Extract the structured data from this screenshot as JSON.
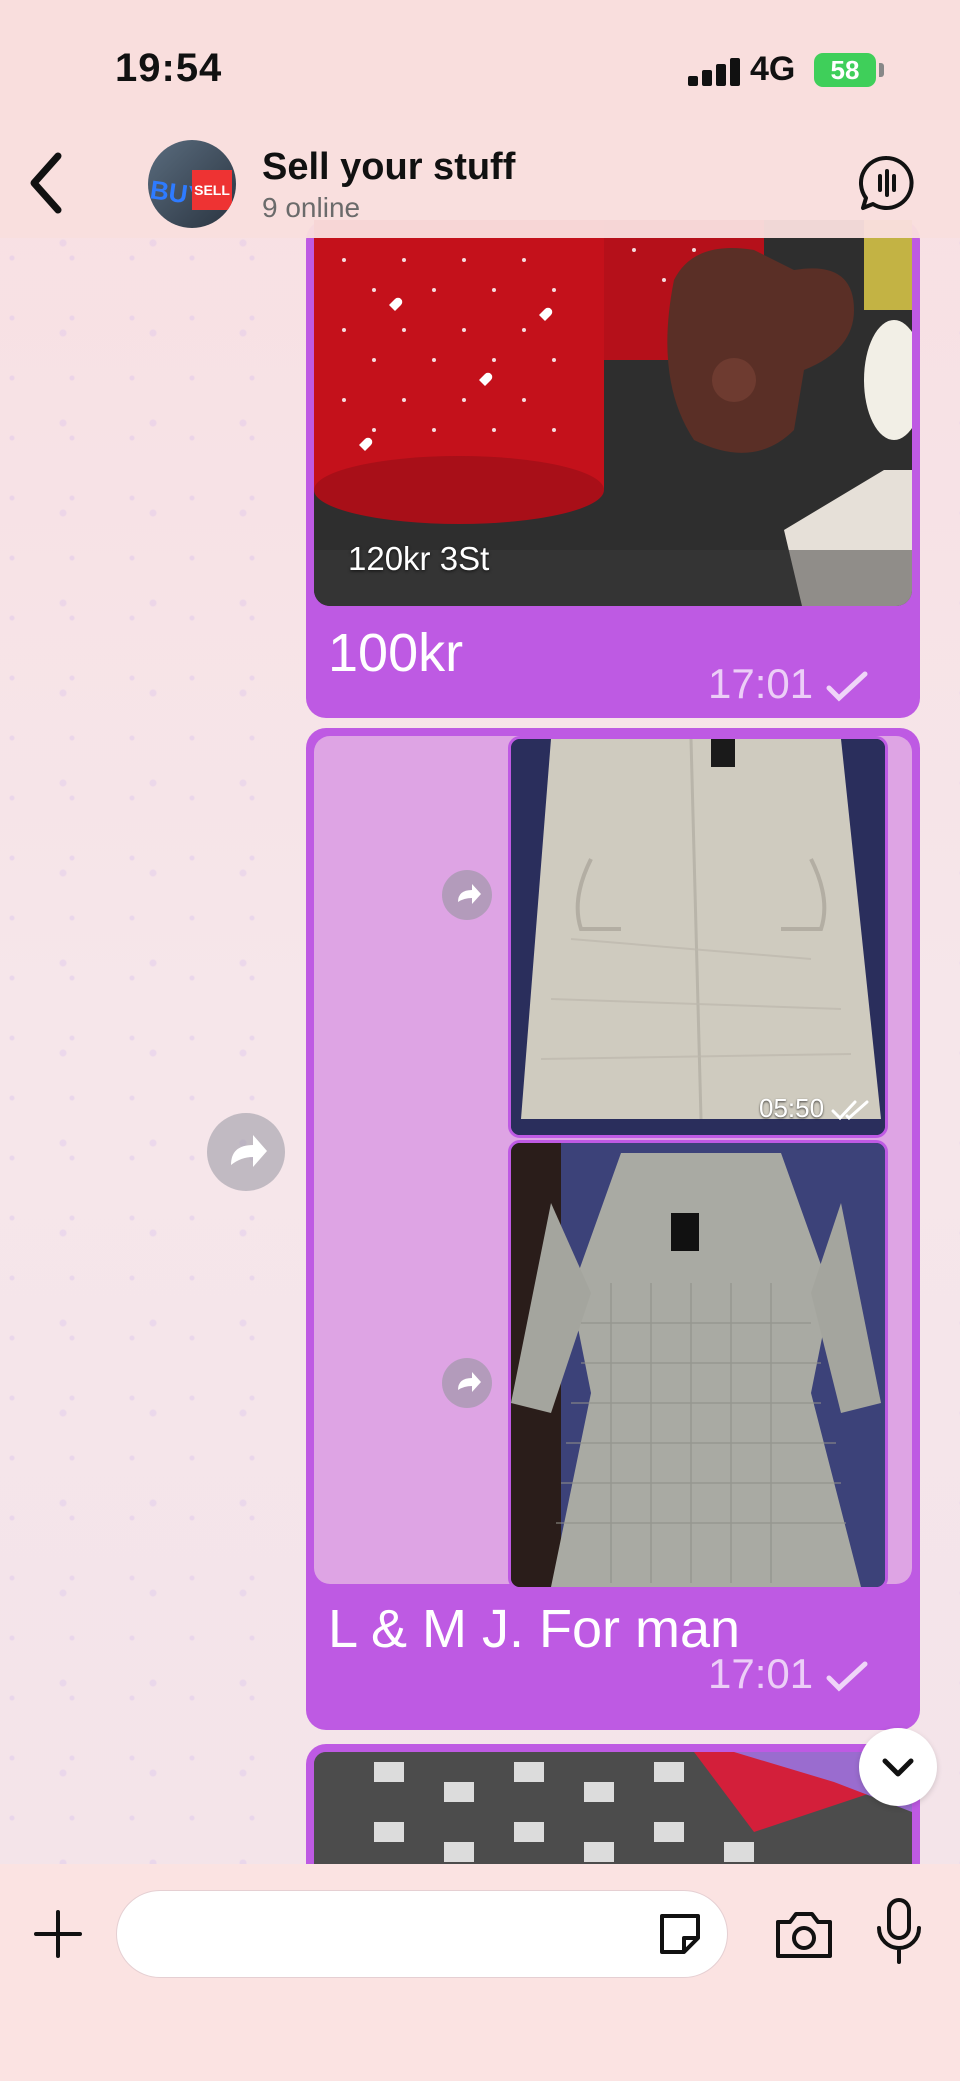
{
  "status_bar": {
    "time": "19:54",
    "network": "4G",
    "battery": "58"
  },
  "header": {
    "title": "Sell your stuff",
    "subtitle": "9 online",
    "avatar_text_left": "BUY",
    "avatar_text_right": "SELL"
  },
  "messages": [
    {
      "photo_label": "120kr 3St",
      "caption": "100kr",
      "time": "17:01"
    },
    {
      "photo_time": "05:50",
      "caption": "L & M J. For man",
      "time": "17:01"
    }
  ],
  "input": {
    "placeholder": ""
  },
  "colors": {
    "bubble": "#be5ae3",
    "background": "#f8e2e4"
  },
  "icons": [
    "back-icon",
    "call-icon",
    "forward-icon",
    "chevron-down-icon",
    "plus-icon",
    "sticker-icon",
    "camera-icon",
    "microphone-icon",
    "checkmark-icon"
  ]
}
